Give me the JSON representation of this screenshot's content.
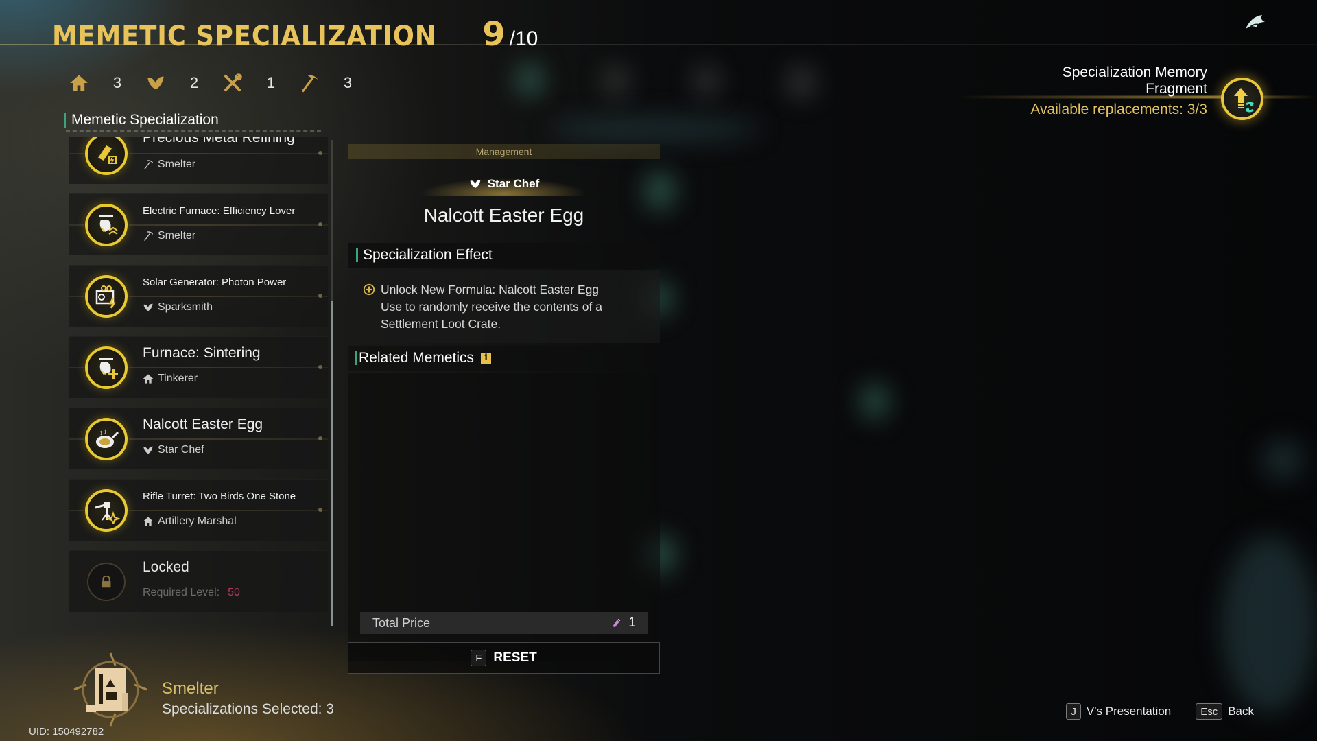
{
  "header": {
    "title": "MEMETIC SPECIALIZATION",
    "current": "9",
    "max": "/10"
  },
  "class_counts": [
    {
      "icon": "house-icon",
      "count": "3"
    },
    {
      "icon": "leaf-icon",
      "count": "2"
    },
    {
      "icon": "tools-icon",
      "count": "1"
    },
    {
      "icon": "pickaxe-icon",
      "count": "3"
    }
  ],
  "section_title": "Memetic Specialization",
  "specializations": [
    {
      "name": "Precious Metal Refining",
      "role": "Smelter",
      "role_icon": "pickaxe-icon",
      "big": true
    },
    {
      "name": "Electric Furnace: Efficiency Lover",
      "role": "Smelter",
      "role_icon": "pickaxe-icon",
      "big": false
    },
    {
      "name": "Solar Generator: Photon Power",
      "role": "Sparksmith",
      "role_icon": "leaf-icon",
      "big": false
    },
    {
      "name": "Furnace: Sintering",
      "role": "Tinkerer",
      "role_icon": "house-icon",
      "big": true
    },
    {
      "name": "Nalcott Easter Egg",
      "role": "Star Chef",
      "role_icon": "leaf-icon",
      "big": true
    },
    {
      "name": "Rifle Turret: Two Birds One Stone",
      "role": "Artillery Marshal",
      "role_icon": "house-icon",
      "big": false
    }
  ],
  "locked": {
    "label": "Locked",
    "required_label": "Required Level:",
    "required_level": "50"
  },
  "list_scroll": {
    "position_fraction": 1.0,
    "visible_fraction": 0.67
  },
  "detail": {
    "category": "Management",
    "role": "Star Chef",
    "name": "Nalcott Easter Egg",
    "effect_title": "Specialization Effect",
    "effect_text_1": "Unlock New Formula: Nalcott Easter Egg",
    "effect_text_2": "Use to randomly receive the contents of a Settlement Loot Crate.",
    "related_title": "Related Memetics",
    "related_info": "i",
    "total_price_label": "Total Price",
    "total_price_value": "1",
    "reset_key": "F",
    "reset_label": "RESET"
  },
  "fragment": {
    "title_line1": "Specialization Memory",
    "title_line2": "Fragment",
    "available": "Available replacements: 3/3"
  },
  "player": {
    "class_name": "Smelter",
    "selected": "Specializations Selected: 3",
    "uid": "UID: 150492782"
  },
  "hints": [
    {
      "key": "J",
      "label": "V's Presentation"
    },
    {
      "key": "Esc",
      "label": "Back"
    }
  ],
  "colors": {
    "gold": "#e8c35a",
    "accent_green": "#3aa37f",
    "required_level": "#b23a63"
  }
}
